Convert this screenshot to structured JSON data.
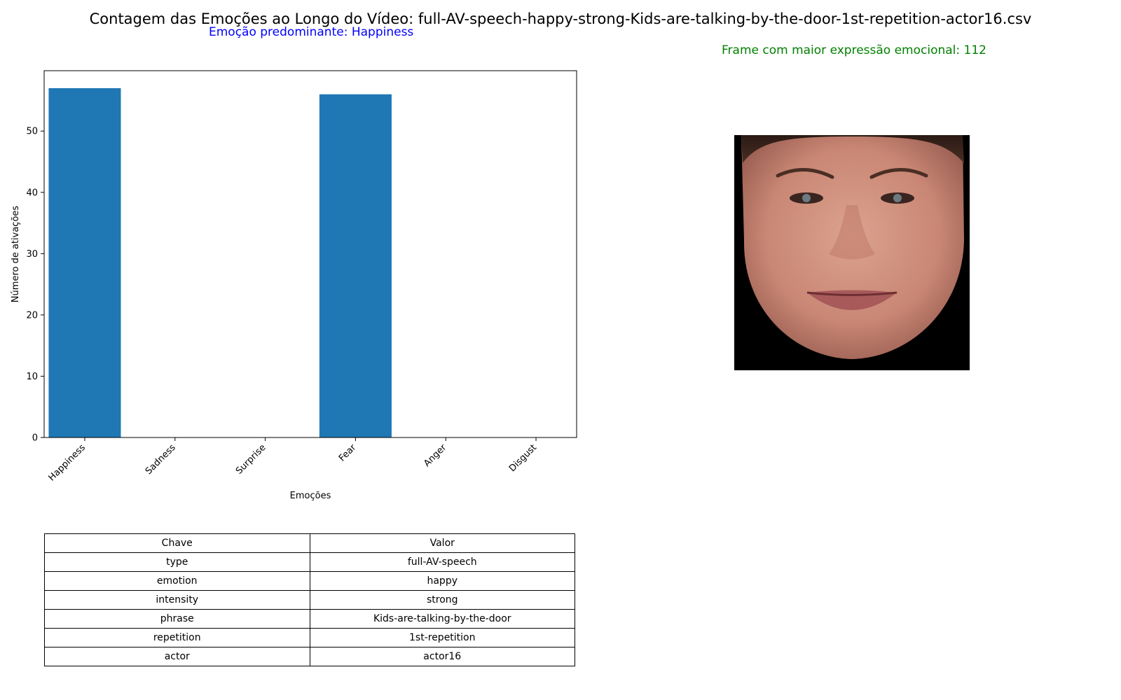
{
  "chart_data": {
    "type": "bar",
    "title": "Contagem das Emoções ao Longo do Vídeo: full-AV-speech-happy-strong-Kids-are-talking-by-the-door-1st-repetition-actor16.csv",
    "subtitle": "Emoção predominante: Happiness",
    "categories": [
      "Happiness",
      "Sadness",
      "Surprise",
      "Fear",
      "Anger",
      "Disgust"
    ],
    "values": [
      57,
      0,
      0,
      56,
      0,
      0
    ],
    "xlabel": "Emoções",
    "ylabel": "Número de ativações",
    "ylim": [
      0,
      59.85
    ],
    "yticks": [
      0,
      10,
      20,
      30,
      40,
      50
    ],
    "bar_color": "#1f77b4",
    "grid": false
  },
  "frame_label": "Frame com maior expressão emocional: 112",
  "table": {
    "header": [
      "Chave",
      "Valor"
    ],
    "rows": [
      [
        "type",
        "full-AV-speech"
      ],
      [
        "emotion",
        "happy"
      ],
      [
        "intensity",
        "strong"
      ],
      [
        "phrase",
        "Kids-are-talking-by-the-door"
      ],
      [
        "repetition",
        "1st-repetition"
      ],
      [
        "actor",
        "actor16"
      ]
    ]
  },
  "colors": {
    "subtitle": "#0000ff",
    "frame_label": "#008000"
  }
}
